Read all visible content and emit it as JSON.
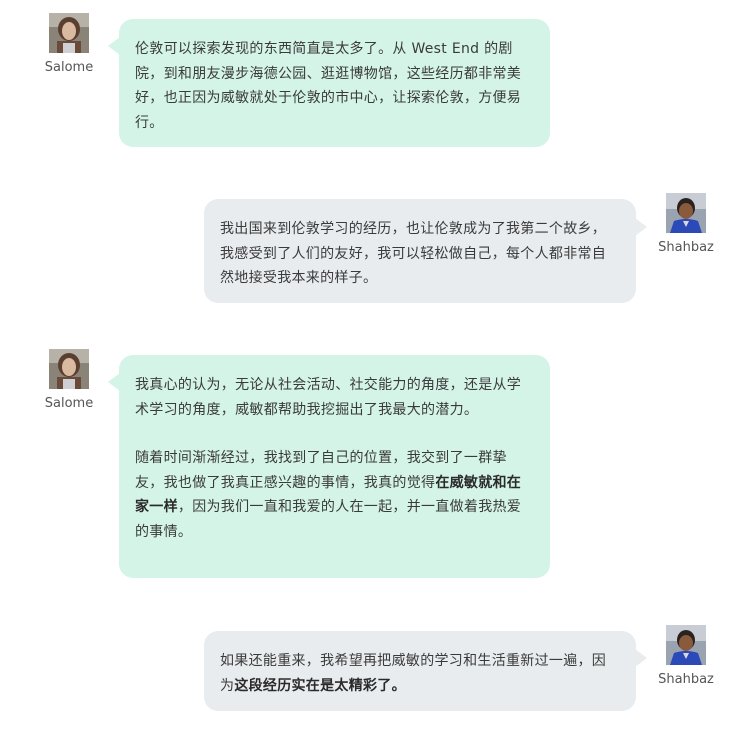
{
  "messages": [
    {
      "sender": "Salome",
      "side": "left",
      "paragraphs": [
        {
          "parts": [
            {
              "text": "伦敦可以探索发现的东西简直是太多了。从 West End 的剧院，到和朋友漫步海德公园、逛逛博物馆，这些经历都非常美好，也正因为威敏就处于伦敦的市中心，让探索伦敦，方便易行。",
              "bold": false
            }
          ]
        }
      ]
    },
    {
      "sender": "Shahbaz",
      "side": "right",
      "paragraphs": [
        {
          "parts": [
            {
              "text": "我出国来到伦敦学习的经历，也让伦敦成为了我第二个故乡，我感受到了人们的友好，我可以轻松做自己，每个人都非常自然地接受我本来的样子。",
              "bold": false
            }
          ]
        }
      ]
    },
    {
      "sender": "Salome",
      "side": "left",
      "paragraphs": [
        {
          "parts": [
            {
              "text": "我真心的认为，无论从社会活动、社交能力的角度，还是从学术学习的角度，威敏都帮助我挖掘出了我最大的潜力。",
              "bold": false
            }
          ]
        },
        {
          "parts": [
            {
              "text": "随着时间渐渐经过，我找到了自己的位置，我交到了一群挚友，我也做了我真正感兴趣的事情，我真的觉得",
              "bold": false
            },
            {
              "text": "在威敏就和在家一样",
              "bold": true
            },
            {
              "text": "，因为我们一直和我爱的人在一起，并一直做着我热爱的事情。",
              "bold": false
            }
          ]
        }
      ]
    },
    {
      "sender": "Shahbaz",
      "side": "right",
      "paragraphs": [
        {
          "parts": [
            {
              "text": "如果还能重来，我希望再把威敏的学习和生活重新过一遍，因为",
              "bold": false
            },
            {
              "text": "这段经历实在是太精彩了。",
              "bold": true
            }
          ]
        }
      ]
    }
  ],
  "colors": {
    "left_bubble": "#d4f4e8",
    "right_bubble": "#e9ecef",
    "text": "#3a3a3a",
    "name": "#555555"
  }
}
